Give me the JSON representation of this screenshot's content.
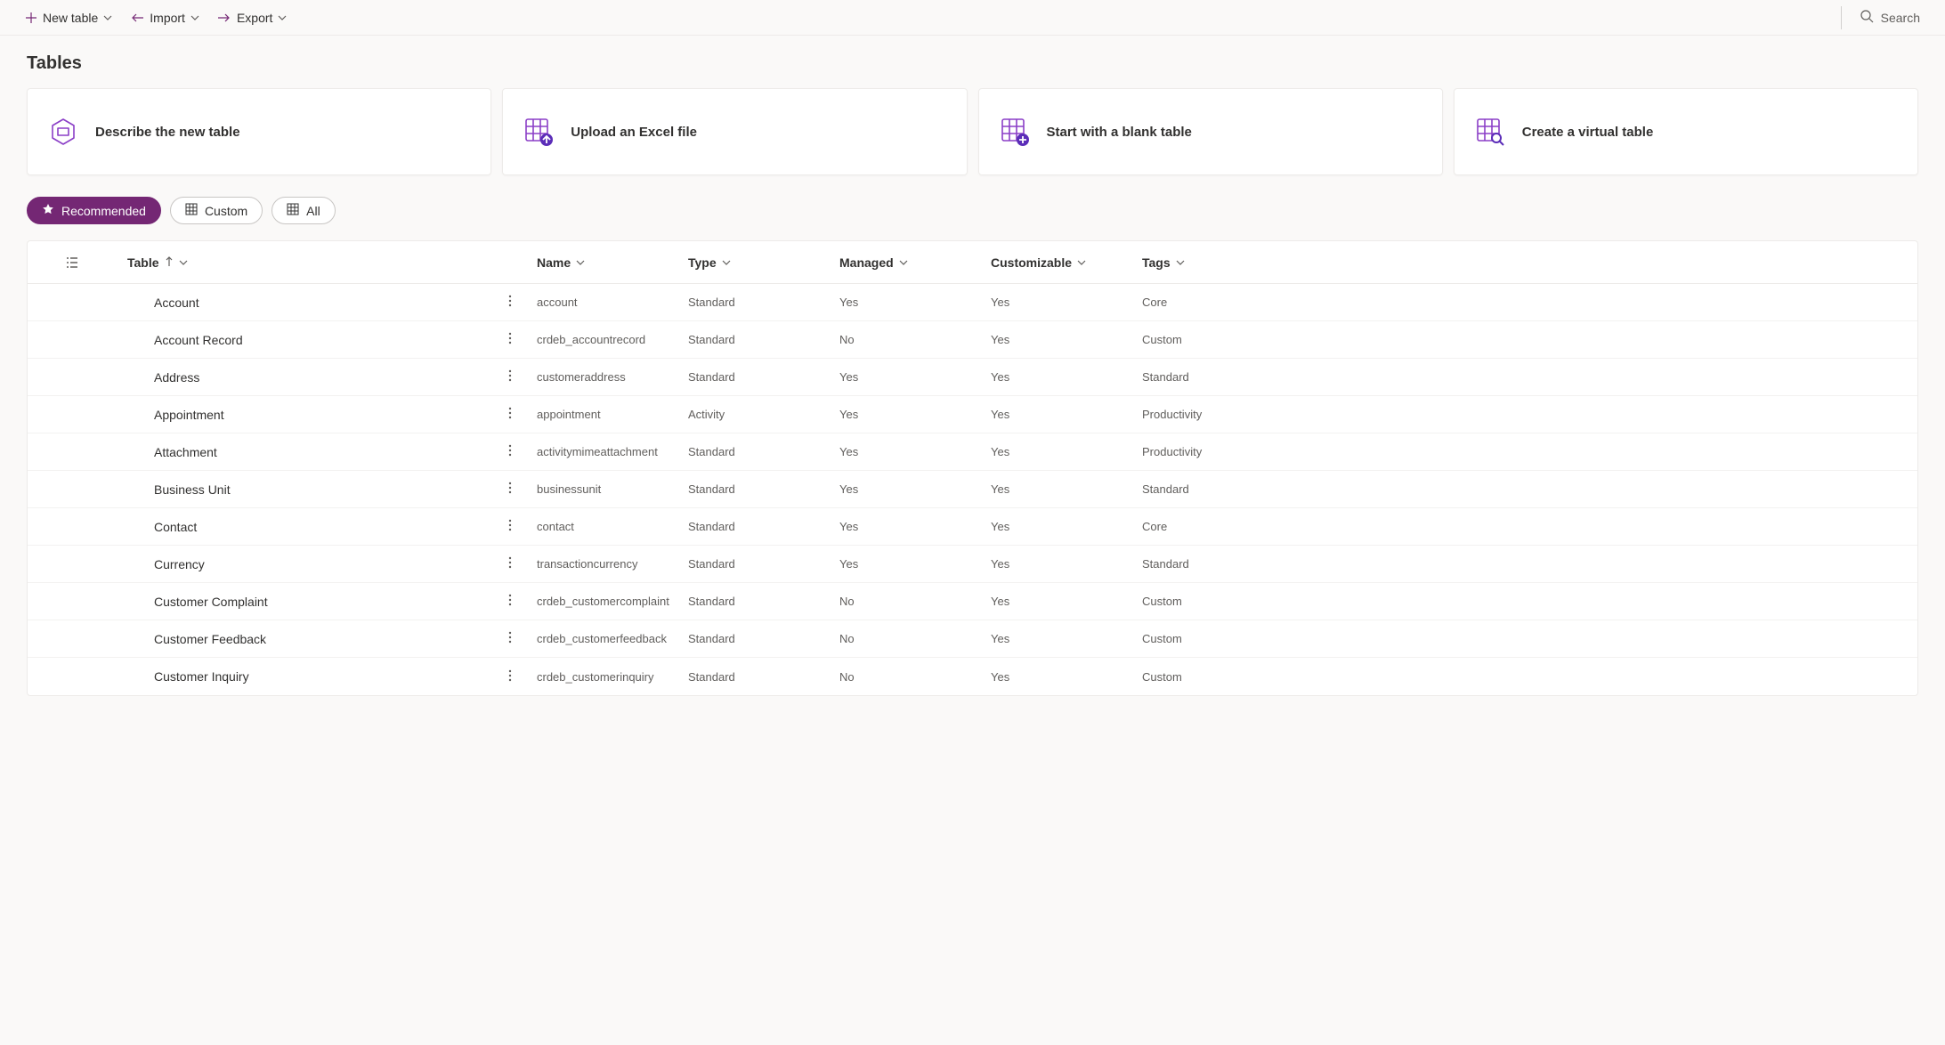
{
  "toolbar": {
    "new_table": "New table",
    "import": "Import",
    "export": "Export",
    "search_placeholder": "Search"
  },
  "page_title": "Tables",
  "cards": [
    {
      "label": "Describe the new table"
    },
    {
      "label": "Upload an Excel file"
    },
    {
      "label": "Start with a blank table"
    },
    {
      "label": "Create a virtual table"
    }
  ],
  "filters": {
    "recommended": "Recommended",
    "custom": "Custom",
    "all": "All"
  },
  "columns": {
    "table": "Table",
    "name": "Name",
    "type": "Type",
    "managed": "Managed",
    "customizable": "Customizable",
    "tags": "Tags"
  },
  "rows": [
    {
      "table": "Account",
      "name": "account",
      "type": "Standard",
      "managed": "Yes",
      "customizable": "Yes",
      "tags": "Core"
    },
    {
      "table": "Account Record",
      "name": "crdeb_accountrecord",
      "type": "Standard",
      "managed": "No",
      "customizable": "Yes",
      "tags": "Custom"
    },
    {
      "table": "Address",
      "name": "customeraddress",
      "type": "Standard",
      "managed": "Yes",
      "customizable": "Yes",
      "tags": "Standard"
    },
    {
      "table": "Appointment",
      "name": "appointment",
      "type": "Activity",
      "managed": "Yes",
      "customizable": "Yes",
      "tags": "Productivity"
    },
    {
      "table": "Attachment",
      "name": "activitymimeattachment",
      "type": "Standard",
      "managed": "Yes",
      "customizable": "Yes",
      "tags": "Productivity"
    },
    {
      "table": "Business Unit",
      "name": "businessunit",
      "type": "Standard",
      "managed": "Yes",
      "customizable": "Yes",
      "tags": "Standard"
    },
    {
      "table": "Contact",
      "name": "contact",
      "type": "Standard",
      "managed": "Yes",
      "customizable": "Yes",
      "tags": "Core"
    },
    {
      "table": "Currency",
      "name": "transactioncurrency",
      "type": "Standard",
      "managed": "Yes",
      "customizable": "Yes",
      "tags": "Standard"
    },
    {
      "table": "Customer Complaint",
      "name": "crdeb_customercomplaint",
      "type": "Standard",
      "managed": "No",
      "customizable": "Yes",
      "tags": "Custom"
    },
    {
      "table": "Customer Feedback",
      "name": "crdeb_customerfeedback",
      "type": "Standard",
      "managed": "No",
      "customizable": "Yes",
      "tags": "Custom"
    },
    {
      "table": "Customer Inquiry",
      "name": "crdeb_customerinquiry",
      "type": "Standard",
      "managed": "No",
      "customizable": "Yes",
      "tags": "Custom"
    }
  ]
}
